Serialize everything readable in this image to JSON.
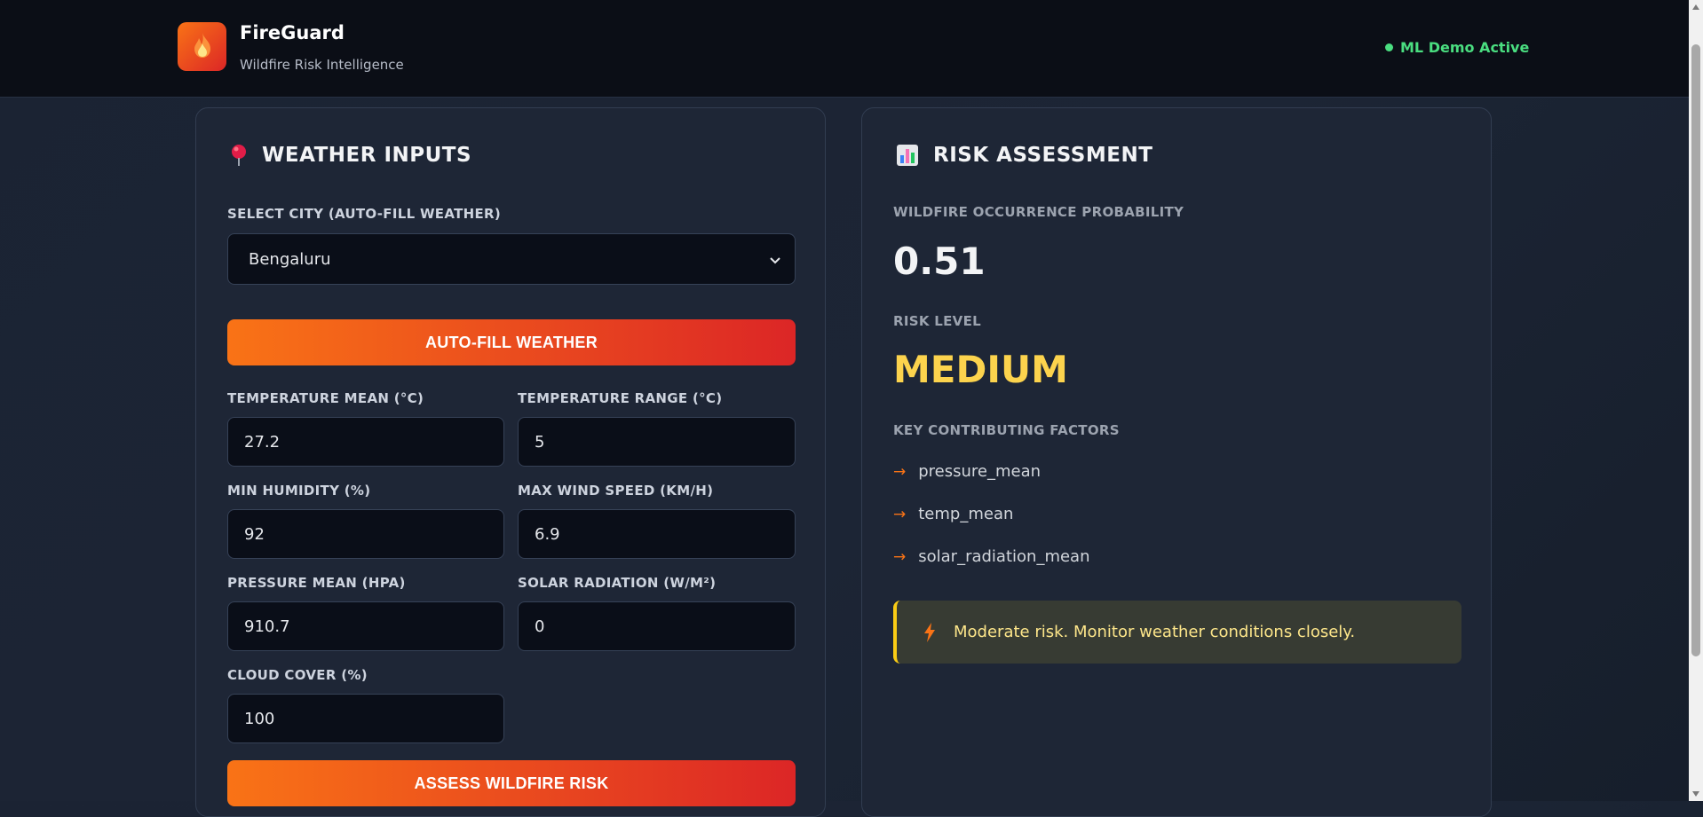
{
  "app": {
    "name": "FireGuard",
    "subtitle": "Wildfire Risk Intelligence",
    "status": "ML Demo Active"
  },
  "inputs": {
    "title": "WEATHER INPUTS",
    "city_label": "SELECT CITY (AUTO-FILL WEATHER)",
    "city_value": "Bengaluru",
    "autofill_label": "AUTO-FILL WEATHER",
    "fields": {
      "temp_mean": {
        "label": "TEMPERATURE MEAN (°C)",
        "value": "27.2"
      },
      "temp_range": {
        "label": "TEMPERATURE RANGE (°C)",
        "value": "5"
      },
      "min_humidity": {
        "label": "MIN HUMIDITY (%)",
        "value": "92"
      },
      "max_wind": {
        "label": "MAX WIND SPEED (KM/H)",
        "value": "6.9"
      },
      "pressure": {
        "label": "PRESSURE MEAN (HPA)",
        "value": "910.7"
      },
      "solar": {
        "label": "SOLAR RADIATION (W/M²)",
        "value": "0"
      },
      "cloud": {
        "label": "CLOUD COVER (%)",
        "value": "100"
      }
    },
    "assess_label": "ASSESS WILDFIRE RISK"
  },
  "assessment": {
    "title": "RISK ASSESSMENT",
    "prob_label": "WILDFIRE OCCURRENCE PROBABILITY",
    "prob_value": "0.51",
    "level_label": "RISK LEVEL",
    "level_value": "MEDIUM",
    "factors_label": "KEY CONTRIBUTING FACTORS",
    "factors": [
      "pressure_mean",
      "temp_mean",
      "solar_radiation_mean"
    ],
    "alert_text": "Moderate risk. Monitor weather conditions closely."
  },
  "colors": {
    "accent_orange": "#f97316",
    "accent_red": "#dc2626",
    "status_green": "#4ade80",
    "risk_medium": "#fcd34d"
  },
  "icons": {
    "logo": "flame-icon",
    "inputs": "map-pin-icon",
    "assessment": "bar-chart-icon",
    "alert": "lightning-bolt-icon",
    "factor": "arrow-right-icon",
    "select": "chevron-down-icon"
  }
}
